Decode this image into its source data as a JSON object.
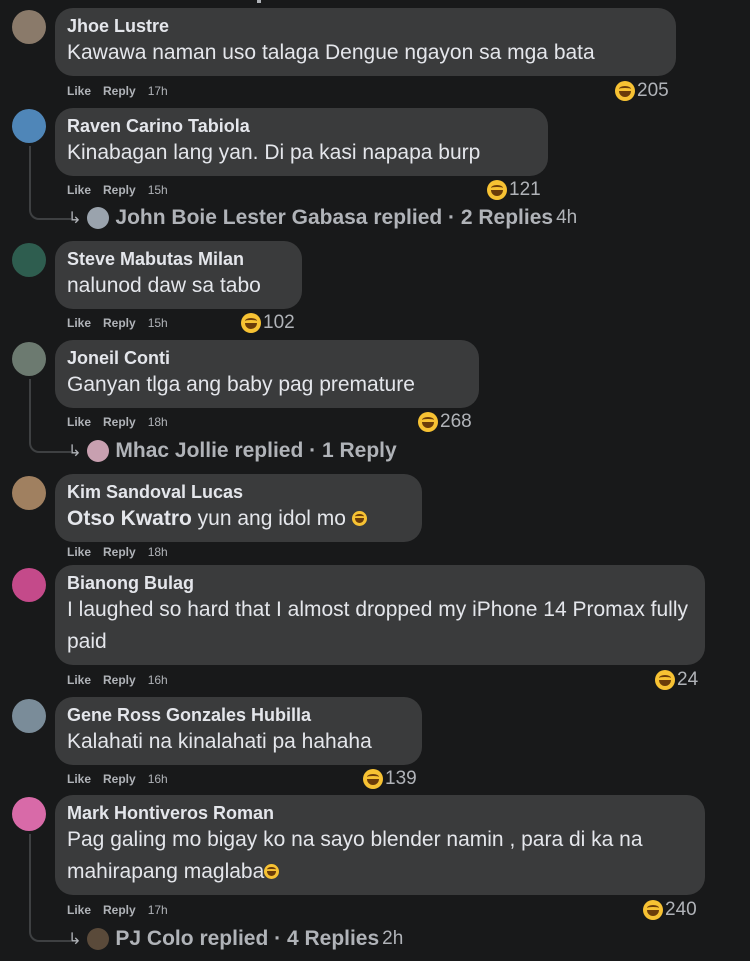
{
  "actions": {
    "like": "Like",
    "reply": "Reply"
  },
  "comments": [
    {
      "author": "Jhoe Lustre",
      "text": "Kawawa naman uso talaga Dengue ngayon sa mga bata",
      "time": "17h",
      "reactions": "205",
      "avatar_color": "#8a7a6a"
    },
    {
      "author": "Raven Carino Tabiola",
      "text": "Kinabagan lang yan. Di pa kasi napapa burp",
      "time": "15h",
      "reactions": "121",
      "avatar_color": "#4f86b8",
      "replies": {
        "name": "John Boie Lester Gabasa",
        "label": "replied · 2 Replies",
        "time": "4h",
        "avatar_color": "#9aa3ad"
      }
    },
    {
      "author": "Steve Mabutas Milan",
      "text": "nalunod daw sa tabo",
      "time": "15h",
      "reactions": "102",
      "avatar_color": "#2e5d4f"
    },
    {
      "author": "Joneil Conti",
      "text": "Ganyan tlga ang baby pag premature",
      "time": "18h",
      "reactions": "268",
      "avatar_color": "#6c7a70",
      "replies": {
        "name": "Mhac Jollie",
        "label": "replied · 1 Reply",
        "time": "",
        "avatar_color": "#c8a0b0"
      }
    },
    {
      "author": "Kim Sandoval Lucas",
      "text_bold": "Otso Kwatro",
      "text": " yun ang idol mo",
      "time": "18h",
      "avatar_color": "#a08060"
    },
    {
      "author": "Bianong Bulag",
      "text": "I laughed so hard that I almost dropped my iPhone 14 Promax fully paid",
      "time": "16h",
      "reactions": "24",
      "avatar_color": "#c44a8a"
    },
    {
      "author": "Gene Ross Gonzales Hubilla",
      "text": "Kalahati na kinalahati pa hahaha",
      "time": "16h",
      "reactions": "139",
      "avatar_color": "#7a8c99"
    },
    {
      "author": "Mark Hontiveros Roman",
      "text": "Pag galing mo bigay ko na sayo blender namin , para di ka na mahirapang maglaba",
      "time": "17h",
      "reactions": "240",
      "avatar_color": "#d86aa8",
      "replies": {
        "name": "PJ Colo",
        "label": "replied · 4 Replies",
        "time": "2h",
        "avatar_color": "#5a4a3a"
      }
    }
  ]
}
